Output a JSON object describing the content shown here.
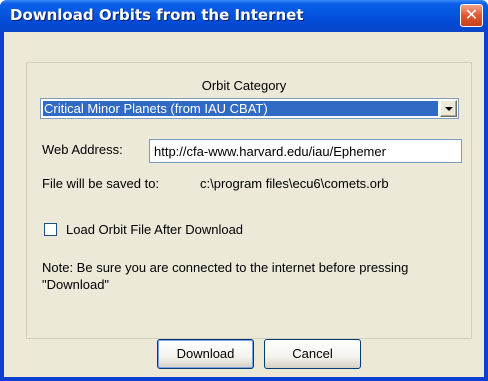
{
  "window": {
    "title": "Download Orbits from the Internet",
    "close_symbol": "✕"
  },
  "form": {
    "category_label": "Orbit Category",
    "category_selected": "Critical Minor Planets (from IAU CBAT)",
    "web_address_label": "Web Address:",
    "web_address_value": "http://cfa-www.harvard.edu/iau/Ephemer",
    "saved_label": "File will be saved to:",
    "saved_path": "c:\\program files\\ecu6\\comets.orb",
    "load_checkbox_label": "Load Orbit File After Download",
    "load_checkbox_checked": false,
    "note": "Note: Be sure you are connected to the internet before pressing \"Download\""
  },
  "buttons": {
    "download_label": "Download",
    "cancel_label": "Cancel"
  },
  "colors": {
    "titlebar": "#0454e0",
    "face": "#ece9d8",
    "selection": "#316ac5"
  },
  "icons": {
    "close": "close-icon",
    "dropdown": "chevron-down-icon"
  }
}
